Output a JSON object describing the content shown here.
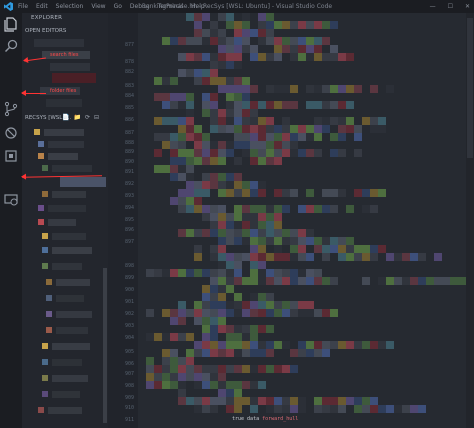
{
  "titlebar": {
    "menu": [
      "File",
      "Edit",
      "Selection",
      "View",
      "Go",
      "Debug",
      "Terminal",
      "Help"
    ],
    "window_title": "RankingPrecise.hh - RecSys [WSL: Ubuntu] - Visual Studio Code",
    "controls": {
      "minimize": "—",
      "maximize": "☐",
      "close": "✕"
    }
  },
  "activity_bar": {
    "icons": [
      "explorer-icon",
      "search-icon",
      "source-control-icon",
      "debug-icon",
      "extensions-icon",
      "remote-explorer-icon"
    ]
  },
  "sidebar": {
    "title": "EXPLORER",
    "open_editors_label": "OPEN EDITORS",
    "recent_label": "RECSYS [WSL: ...",
    "recent_tools": [
      "📄",
      "📁",
      "⟳",
      "⊟"
    ]
  },
  "annotations": [
    {
      "text": "search files"
    },
    {
      "text": "folder files"
    },
    {
      "text": ""
    }
  ],
  "gutter": {
    "lines": [
      "877",
      "878",
      "882",
      "883",
      "884",
      "885",
      "886",
      "887",
      "888",
      "889",
      "890",
      "891",
      "892",
      "893",
      "894",
      "895",
      "896",
      "897",
      "898",
      "899",
      "900",
      "901",
      "902",
      "903",
      "904",
      "905",
      "906",
      "907",
      "908",
      "909",
      "910",
      "911",
      "912",
      "913"
    ]
  },
  "bottom_code": {
    "keyword": "true data",
    "call": "forward_hull"
  },
  "colors": {
    "activity_bg": "#1b1d22",
    "sidebar_bg": "#23262d",
    "editor_bg": "#262a31",
    "accent_arrow": "#ff3333"
  }
}
